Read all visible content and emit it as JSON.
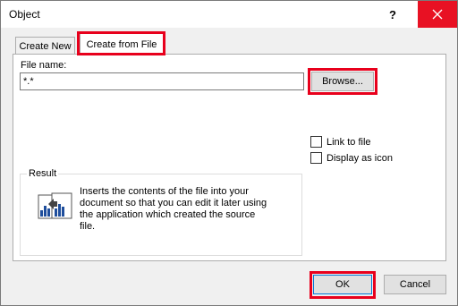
{
  "window": {
    "title": "Object",
    "help_label": "?",
    "close_icon": "close-icon"
  },
  "tabs": [
    {
      "label": "Create New",
      "active": false
    },
    {
      "label": "Create from File",
      "active": true
    }
  ],
  "file_name": {
    "label": "File name:",
    "value": "*.*"
  },
  "browse_button": "Browse...",
  "options": {
    "link_to_file": {
      "label": "Link to file",
      "checked": false
    },
    "display_as_icon": {
      "label": "Display as icon",
      "checked": false
    }
  },
  "result": {
    "label": "Result",
    "lines": [
      "Inserts the contents of the file into your",
      "document so that you can edit it later using",
      "the application which created the source",
      "file."
    ],
    "icon": "insert-file-icon"
  },
  "buttons": {
    "ok": "OK",
    "cancel": "Cancel"
  },
  "colors": {
    "highlight": "#e8001c",
    "close_bg": "#e81123",
    "dialog_bg": "#f0f0f0",
    "button_bg": "#e1e1e1",
    "default_button_border": "#0078d7"
  }
}
